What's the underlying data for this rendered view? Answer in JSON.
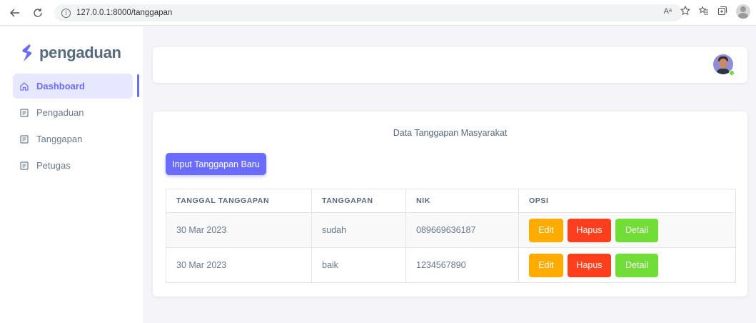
{
  "browser": {
    "url": "127.0.0.1:8000/tanggapan",
    "read_aloud_label": "Aᵃ"
  },
  "sidebar": {
    "brand": "pengaduan",
    "items": [
      {
        "label": "Dashboard",
        "icon": "home-icon",
        "active": true
      },
      {
        "label": "Pengaduan",
        "icon": "document-icon",
        "active": false
      },
      {
        "label": "Tanggapan",
        "icon": "document-icon",
        "active": false
      },
      {
        "label": "Petugas",
        "icon": "document-icon",
        "active": false
      }
    ]
  },
  "navbar": {
    "avatar_status_color": "#71dd37"
  },
  "main": {
    "title": "Data Tanggapan Masyarakat",
    "add_button": "Input Tanggapan Baru",
    "columns": [
      "TANGGAL TANGGAPAN",
      "TANGGAPAN",
      "NIK",
      "OPSI"
    ],
    "rows": [
      {
        "tanggal": "30 Mar 2023",
        "tanggapan": "sudah",
        "nik": "089669636187"
      },
      {
        "tanggal": "30 Mar 2023",
        "tanggapan": "baik",
        "nik": "1234567890"
      }
    ],
    "actions": {
      "edit": "Edit",
      "hapus": "Hapus",
      "detail": "Detail"
    }
  },
  "colors": {
    "primary": "#696cff",
    "warning": "#ffab00",
    "danger": "#ff3e1d",
    "success": "#71dd37"
  }
}
